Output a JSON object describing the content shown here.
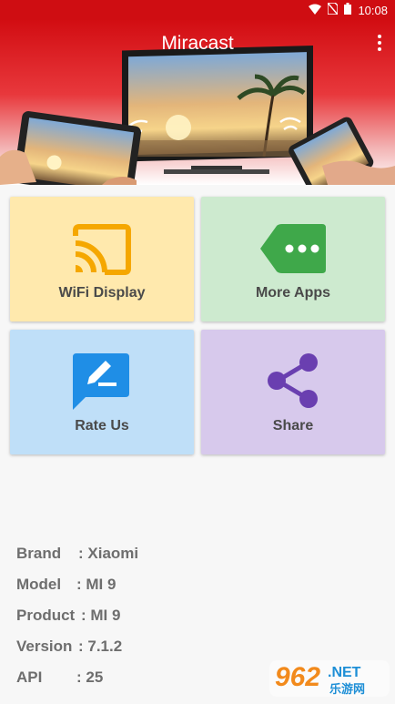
{
  "status_bar": {
    "time": "10:08"
  },
  "app": {
    "title": "Miracast"
  },
  "tiles": [
    {
      "label": "WiFi Display",
      "bg": "#ffe9ad",
      "icon": "cast-icon",
      "icon_color": "#f5a700"
    },
    {
      "label": "More Apps",
      "bg": "#cdeacf",
      "icon": "more-apps-tag-icon",
      "icon_color": "#3fa84a"
    },
    {
      "label": "Rate Us",
      "bg": "#bfdff8",
      "icon": "rate-edit-icon",
      "icon_color": "#1f8ee6"
    },
    {
      "label": "Share",
      "bg": "#d7c9ec",
      "icon": "share-icon",
      "icon_color": "#6a3fb0"
    }
  ],
  "device_info": [
    {
      "key": "Brand",
      "value": ": Xiaomi"
    },
    {
      "key": "Model",
      "value": ": MI 9"
    },
    {
      "key": "Product",
      "value": ": MI 9"
    },
    {
      "key": "Version",
      "value": ": 7.1.2"
    },
    {
      "key": "API",
      "value": ": 25"
    }
  ],
  "watermark": {
    "number": "962",
    "suffix": ".NET",
    "sub": "乐游网"
  }
}
